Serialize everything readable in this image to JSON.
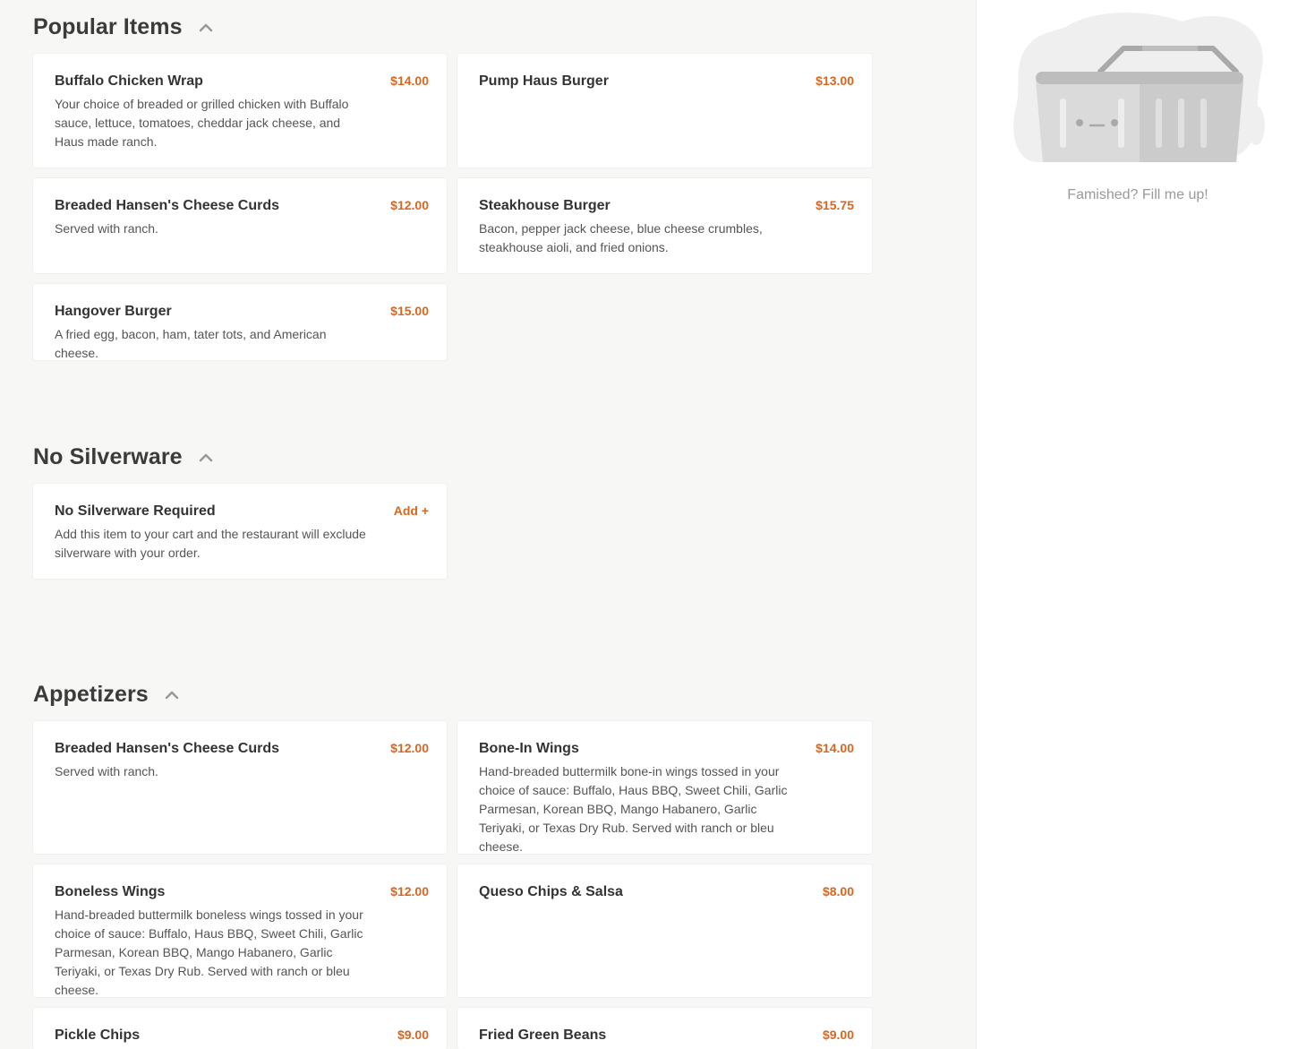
{
  "sections": {
    "popular": {
      "title": "Popular Items",
      "items": [
        {
          "name": "Buffalo Chicken Wrap",
          "price": "$14.00",
          "desc": "Your choice of breaded or grilled chicken with Buffalo sauce, lettuce, tomatoes, cheddar jack cheese, and Haus made ranch."
        },
        {
          "name": "Pump Haus Burger",
          "price": "$13.00",
          "desc": ""
        },
        {
          "name": "Breaded Hansen's Cheese Curds",
          "price": "$12.00",
          "desc": "Served with ranch."
        },
        {
          "name": "Steakhouse Burger",
          "price": "$15.75",
          "desc": "Bacon, pepper jack cheese, blue cheese crumbles, steakhouse aioli, and fried onions."
        },
        {
          "name": "Hangover Burger",
          "price": "$15.00",
          "desc": "A fried egg, bacon, ham, tater tots, and American cheese."
        }
      ]
    },
    "silverware": {
      "title": "No Silverware",
      "items": [
        {
          "name": "No Silverware Required",
          "price": "Add +",
          "desc": "Add this item to your cart and the restaurant will exclude silverware with your order."
        }
      ]
    },
    "appetizers": {
      "title": "Appetizers",
      "items": [
        {
          "name": "Breaded Hansen's Cheese Curds",
          "price": "$12.00",
          "desc": "Served with ranch."
        },
        {
          "name": "Bone-In Wings",
          "price": "$14.00",
          "desc": "Hand-breaded buttermilk bone-in wings tossed in your choice of sauce: Buffalo, Haus BBQ, Sweet Chili, Garlic Parmesan, Korean BBQ, Mango Habanero, Garlic Teriyaki, or Texas Dry Rub. Served with ranch or bleu cheese."
        },
        {
          "name": "Boneless Wings",
          "price": "$12.00",
          "desc": "Hand-breaded buttermilk boneless wings tossed in your choice of sauce: Buffalo, Haus BBQ, Sweet Chili, Garlic Parmesan, Korean BBQ, Mango Habanero, Garlic Teriyaki, or Texas Dry Rub. Served with ranch or bleu cheese."
        },
        {
          "name": "Queso Chips & Salsa",
          "price": "$8.00",
          "desc": ""
        },
        {
          "name": "Pickle Chips",
          "price": "$9.00",
          "desc": ""
        },
        {
          "name": "Fried Green Beans",
          "price": "$9.00",
          "desc": ""
        }
      ]
    }
  },
  "cart": {
    "empty_message": "Famished? Fill me up!",
    "illustration_icon": "empty-basket-icon"
  },
  "colors": {
    "accent": "#d9661f",
    "background": "#f7f7f6",
    "card": "#ffffff"
  }
}
